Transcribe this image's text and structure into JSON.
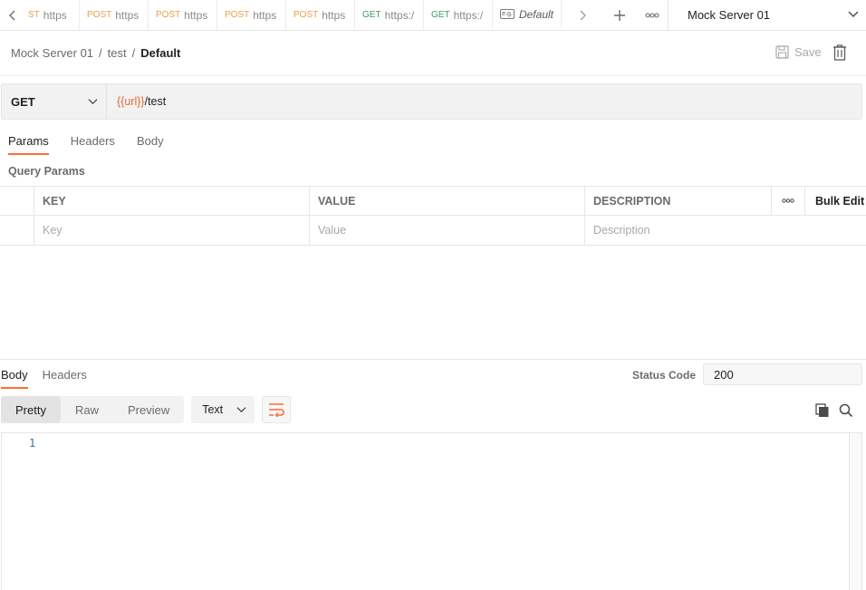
{
  "tabs": [
    {
      "method": "ST",
      "method_type": "post",
      "url": "https"
    },
    {
      "method": "POST",
      "method_type": "post",
      "url": "https"
    },
    {
      "method": "POST",
      "method_type": "post",
      "url": "https"
    },
    {
      "method": "POST",
      "method_type": "post",
      "url": "https"
    },
    {
      "method": "POST",
      "method_type": "post",
      "url": "https"
    },
    {
      "method": "GET",
      "method_type": "get",
      "url": "https:/"
    },
    {
      "method": "GET",
      "method_type": "get",
      "url": "https:/"
    }
  ],
  "active_tab": {
    "icon_text": "e.g.",
    "label": "Default"
  },
  "environment": {
    "selected": "Mock Server 01"
  },
  "breadcrumb": {
    "collection": "Mock Server 01",
    "sep1": "/",
    "request": "test",
    "sep2": "/",
    "example": "Default"
  },
  "toolbar": {
    "save_label": "Save"
  },
  "request": {
    "method": "GET",
    "url_var": "{{url}}",
    "url_path": "/test"
  },
  "request_tabs": [
    "Params",
    "Headers",
    "Body"
  ],
  "query_params": {
    "label": "Query Params",
    "headers": {
      "key": "KEY",
      "value": "VALUE",
      "description": "DESCRIPTION",
      "bulk_edit": "Bulk Edit"
    },
    "placeholders": {
      "key": "Key",
      "value": "Value",
      "description": "Description"
    }
  },
  "response": {
    "tabs": [
      "Body",
      "Headers"
    ],
    "status_label": "Status Code",
    "status_value": "200",
    "view_modes": [
      "Pretty",
      "Raw",
      "Preview"
    ],
    "language": "Text",
    "line_number": "1"
  },
  "colors": {
    "accent": "#ff6c37",
    "post": "#e9a14a",
    "get": "#3d9c60",
    "var": "#e46a3a"
  }
}
